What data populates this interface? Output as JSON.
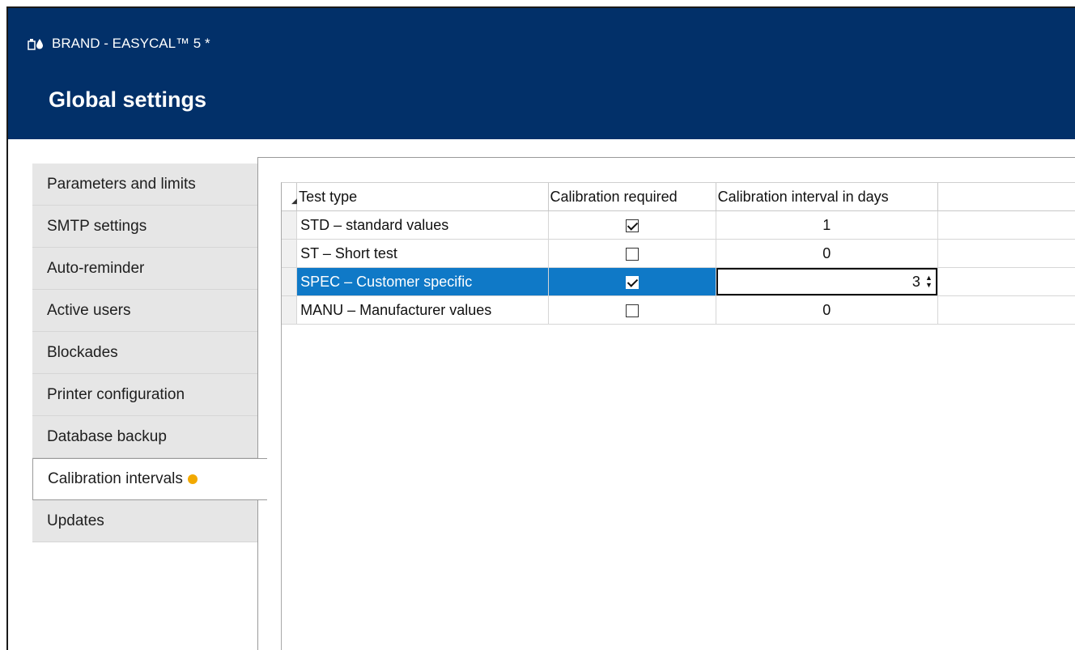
{
  "window": {
    "app_title": "BRAND - EASYCAL™ 5 *",
    "page_title": "Global settings",
    "header_color": "#023069",
    "app_icon": "app-logo-icon"
  },
  "sidebar": {
    "items": [
      {
        "label": "Parameters and limits"
      },
      {
        "label": "SMTP settings"
      },
      {
        "label": "Auto-reminder"
      },
      {
        "label": "Active users"
      },
      {
        "label": "Blockades"
      },
      {
        "label": "Printer configuration"
      },
      {
        "label": "Database backup"
      },
      {
        "label": "Calibration intervals",
        "active": true,
        "modified_indicator": "orange-dot",
        "indicator_color": "#f2a900"
      },
      {
        "label": "Updates"
      }
    ]
  },
  "grid": {
    "columns": [
      "Test type",
      "Calibration required",
      "Calibration interval in days"
    ],
    "rows": [
      {
        "test_type": "STD – standard values",
        "calibration_required": true,
        "interval": "1"
      },
      {
        "test_type": "ST – Short test",
        "calibration_required": false,
        "interval": "0"
      },
      {
        "test_type": "SPEC – Customer specific",
        "calibration_required": true,
        "interval": "3",
        "selected": true,
        "editing": true
      },
      {
        "test_type": "MANU – Manufacturer values",
        "calibration_required": false,
        "interval": "0"
      }
    ],
    "selection_color": "#0f79c7"
  }
}
